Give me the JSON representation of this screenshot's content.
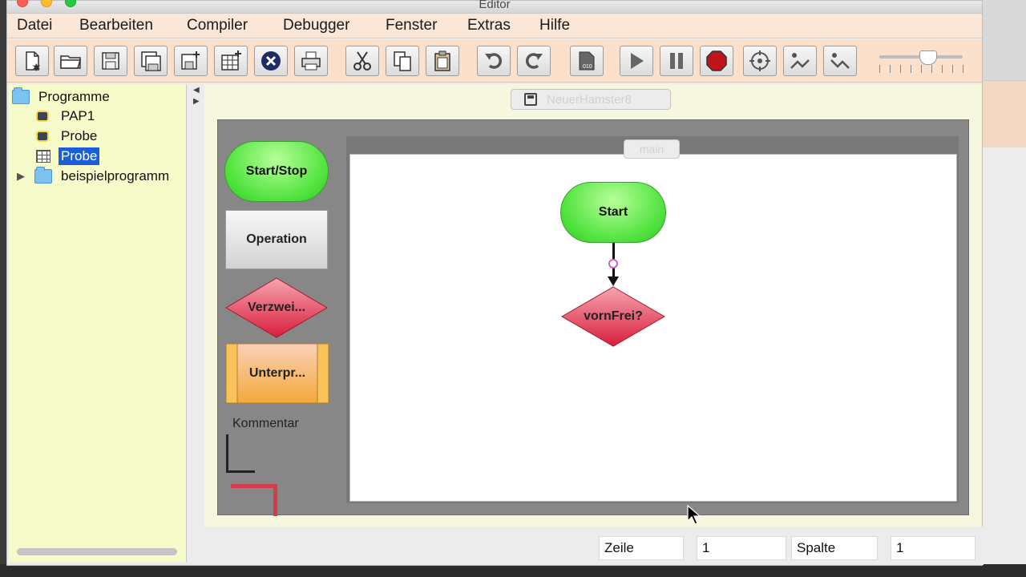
{
  "window": {
    "title": "Editor"
  },
  "menu": [
    "Datei",
    "Bearbeiten",
    "Compiler",
    "Debugger",
    "Fenster",
    "Extras",
    "Hilfe"
  ],
  "toolbar": {
    "buttons": [
      "new-file-icon",
      "open-folder-icon",
      "save-icon",
      "save-as-icon",
      "save-all-icon",
      "new-table-icon",
      "close-circle-icon",
      "print-icon",
      "cut-icon",
      "copy-icon",
      "paste-icon",
      "undo-icon",
      "redo-icon",
      "compile-icon",
      "play-icon",
      "pause-icon",
      "stop-icon",
      "step-target-icon",
      "step-over-icon",
      "step-back-icon"
    ],
    "speed_slider_value": 0.6
  },
  "tree": {
    "root": "Programme",
    "items": [
      {
        "label": "PAP1",
        "icon": "pap-icon"
      },
      {
        "label": "Probe",
        "icon": "pap-icon"
      },
      {
        "label": "Probe",
        "icon": "table-icon",
        "selected": true
      },
      {
        "label": "beispielprogramm",
        "icon": "folder-icon",
        "collapsed": true
      }
    ]
  },
  "editor": {
    "file_tab": "NeuerHamster8",
    "main_tab": "main",
    "palette": {
      "start_stop": "Start/Stop",
      "operation": "Operation",
      "branch": "Verzwei...",
      "subprogram": "Unterpr...",
      "comment": "Kommentar"
    },
    "flow": {
      "start": "Start",
      "condition": "vornFrei?"
    }
  },
  "status": {
    "row_label": "Zeile",
    "row_value": "1",
    "col_label": "Spalte",
    "col_value": "1"
  },
  "colors": {
    "menubar_bg": "#fbe7d7",
    "toolbar_bg": "#fbe0cb",
    "tree_bg": "#f6fbc9",
    "selection": "#1b5fd6",
    "start_green": "#4fe23c",
    "branch_red": "#e0435a",
    "subprogram_orange": "#f6b35a"
  }
}
